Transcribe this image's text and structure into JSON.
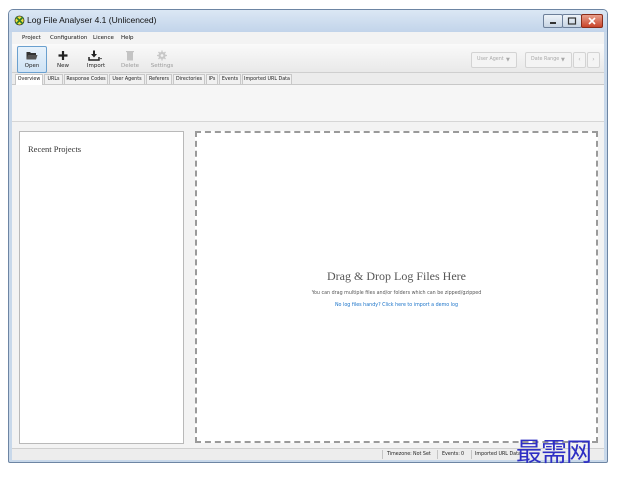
{
  "window": {
    "title": "Log File Analyser 4.1 (Unlicenced)",
    "icons": [
      "app-logo-icon",
      "minimize-icon",
      "maximize-icon",
      "close-icon"
    ]
  },
  "menu": [
    "Project",
    "Configuration",
    "Licence",
    "Help"
  ],
  "toolbar": {
    "open": "Open",
    "new": "New",
    "import": "Import",
    "delete": "Delete",
    "settings": "Settings",
    "user_agent": "User Agent",
    "date_range": "Date Range",
    "prev": "‹",
    "next": "›"
  },
  "tabs": [
    "Overview",
    "URLs",
    "Response Codes",
    "User Agents",
    "Referers",
    "Directories",
    "IPs",
    "Events",
    "Imported URL Data"
  ],
  "left_panel": {
    "title": "Recent Projects"
  },
  "drop": {
    "title": "Drag & Drop Log Files Here",
    "subtitle": "You can drag multiple files and/or folders which can be zipped/gzipped",
    "link": "No log files handy? Click here to import a demo log"
  },
  "status": {
    "timezone_label": "Timezone:",
    "timezone_value": "Not Set",
    "events_label": "Events:",
    "events_value": "0",
    "imported_label": "Imported URL Data"
  },
  "watermark": "最需网",
  "colors": {
    "accent": "#1a73c9",
    "drop_border": "#9a9a9a",
    "watermark": "#2f2fc4"
  }
}
